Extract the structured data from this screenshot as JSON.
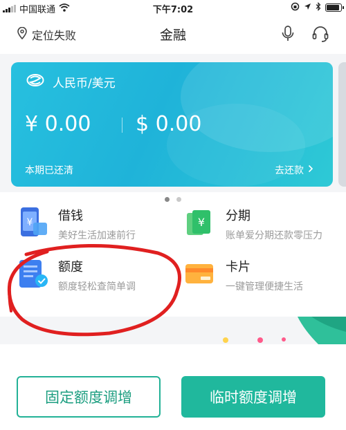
{
  "status_bar": {
    "carrier": "中国联通",
    "time": "下午7:02"
  },
  "nav": {
    "location": "定位失败",
    "title": "金融",
    "icons": [
      "location-pin-icon",
      "microphone-icon",
      "headset-icon"
    ]
  },
  "card": {
    "currency_label": "人民币/美元",
    "cny_amount": "¥ 0.00",
    "usd_amount": "$ 0.00",
    "status": "本期已还清",
    "repay_label": "去还款"
  },
  "carousel": {
    "pages": 2,
    "active": 1
  },
  "features": [
    {
      "name": "借钱",
      "desc": "美好生活加速前行",
      "icon": "phone-money-icon"
    },
    {
      "name": "分期",
      "desc": "账单爱分期还款零压力",
      "icon": "installment-icon"
    },
    {
      "name": "额度",
      "desc": "额度轻松查简单调",
      "icon": "credit-limit-icon"
    },
    {
      "name": "卡片",
      "desc": "一键管理便捷生活",
      "icon": "card-icon"
    }
  ],
  "buttons": {
    "fixed_increase": "固定额度调增",
    "temp_increase": "临时额度调增"
  },
  "colors": {
    "card": "#27c0df",
    "accent_green": "#20b89d",
    "annotation_red": "#e02020"
  }
}
